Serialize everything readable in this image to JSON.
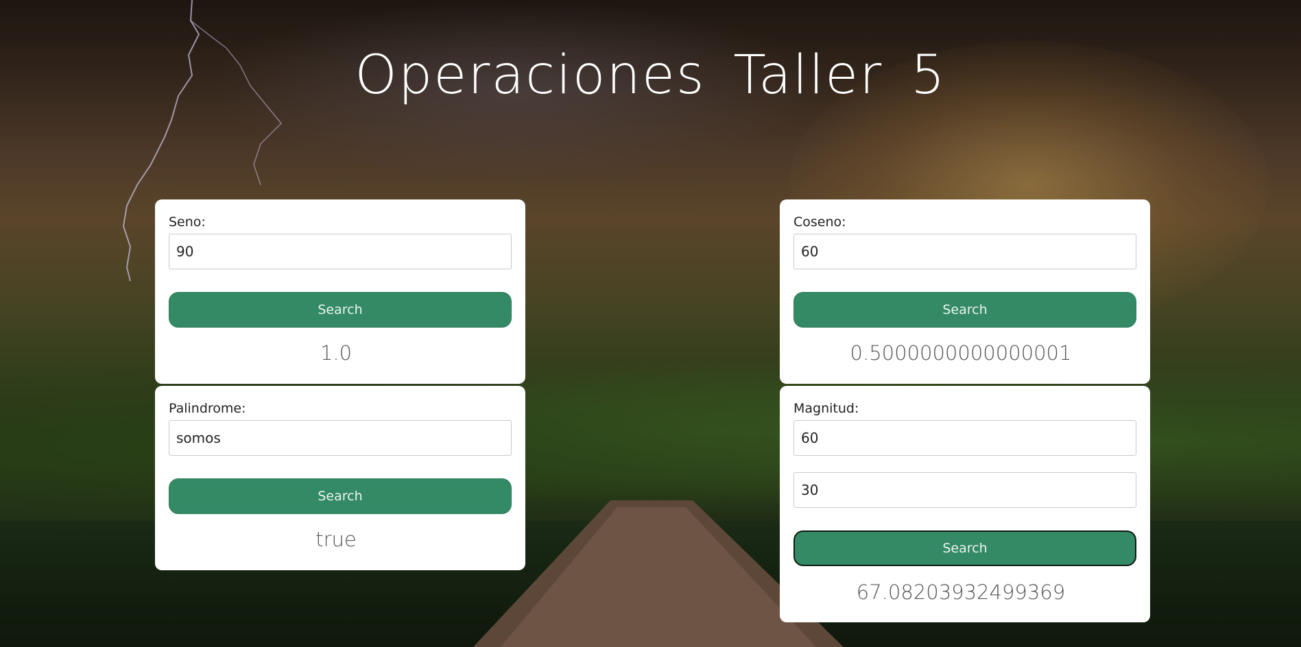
{
  "page": {
    "title": "Operaciones  Taller 5"
  },
  "cards": {
    "seno": {
      "label": "Seno:",
      "input_value": "90",
      "button_label": "Search",
      "result": "1.0"
    },
    "coseno": {
      "label": "Coseno:",
      "input_value": "60",
      "button_label": "Search",
      "result": "0.5000000000000001"
    },
    "palindrome": {
      "label": "Palindrome:",
      "input_value": "somos",
      "button_label": "Search",
      "result": "true"
    },
    "magnitud": {
      "label": "Magnitud:",
      "input_value_1": "60",
      "input_value_2": "30",
      "button_label": "Search",
      "result": "67.08203932499369"
    }
  },
  "colors": {
    "button_bg": "#338a64",
    "card_bg": "#ffffff",
    "title_color": "#ffffff",
    "result_color": "#555555"
  }
}
